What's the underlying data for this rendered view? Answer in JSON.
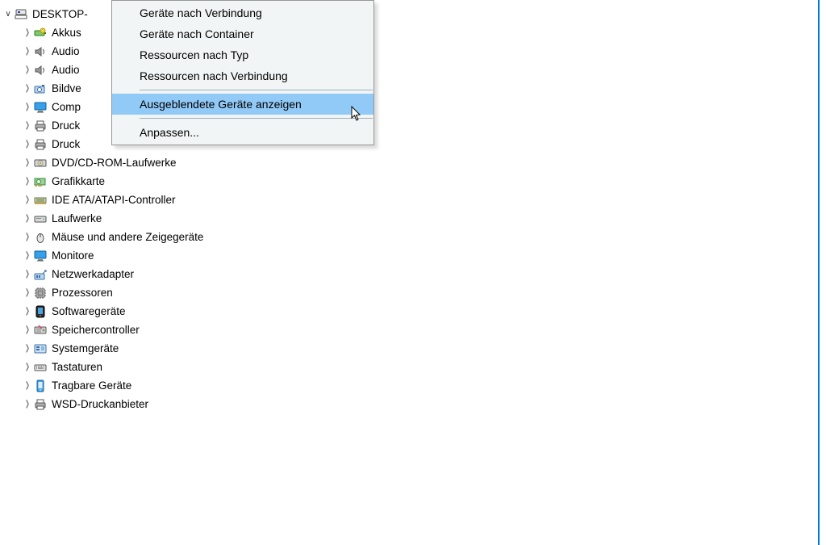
{
  "root": {
    "label": "DESKTOP-"
  },
  "items": [
    {
      "label": "Akkus",
      "icon": "battery"
    },
    {
      "label": "Audio",
      "icon": "audio"
    },
    {
      "label": "Audio",
      "icon": "audio"
    },
    {
      "label": "Bildve",
      "icon": "camera"
    },
    {
      "label": "Comp",
      "icon": "monitor"
    },
    {
      "label": "Druck",
      "icon": "printer"
    },
    {
      "label": "Druck",
      "icon": "printer"
    },
    {
      "label": "DVD/CD-ROM-Laufwerke",
      "icon": "dvd"
    },
    {
      "label": "Grafikkarte",
      "icon": "gpu"
    },
    {
      "label": "IDE ATA/ATAPI-Controller",
      "icon": "ide"
    },
    {
      "label": "Laufwerke",
      "icon": "drive"
    },
    {
      "label": "Mäuse und andere Zeigegeräte",
      "icon": "mouse"
    },
    {
      "label": "Monitore",
      "icon": "monitor"
    },
    {
      "label": "Netzwerkadapter",
      "icon": "network"
    },
    {
      "label": "Prozessoren",
      "icon": "cpu"
    },
    {
      "label": "Softwaregeräte",
      "icon": "software"
    },
    {
      "label": "Speichercontroller",
      "icon": "storage"
    },
    {
      "label": "Systemgeräte",
      "icon": "system"
    },
    {
      "label": "Tastaturen",
      "icon": "keyboard"
    },
    {
      "label": "Tragbare Geräte",
      "icon": "portable"
    },
    {
      "label": "WSD-Druckanbieter",
      "icon": "printer"
    }
  ],
  "menu": {
    "group1": [
      "Geräte nach Verbindung",
      "Geräte nach Container",
      "Ressourcen nach Typ",
      "Ressourcen nach Verbindung"
    ],
    "highlighted": "Ausgeblendete Geräte anzeigen",
    "group3": [
      "Anpassen..."
    ]
  }
}
